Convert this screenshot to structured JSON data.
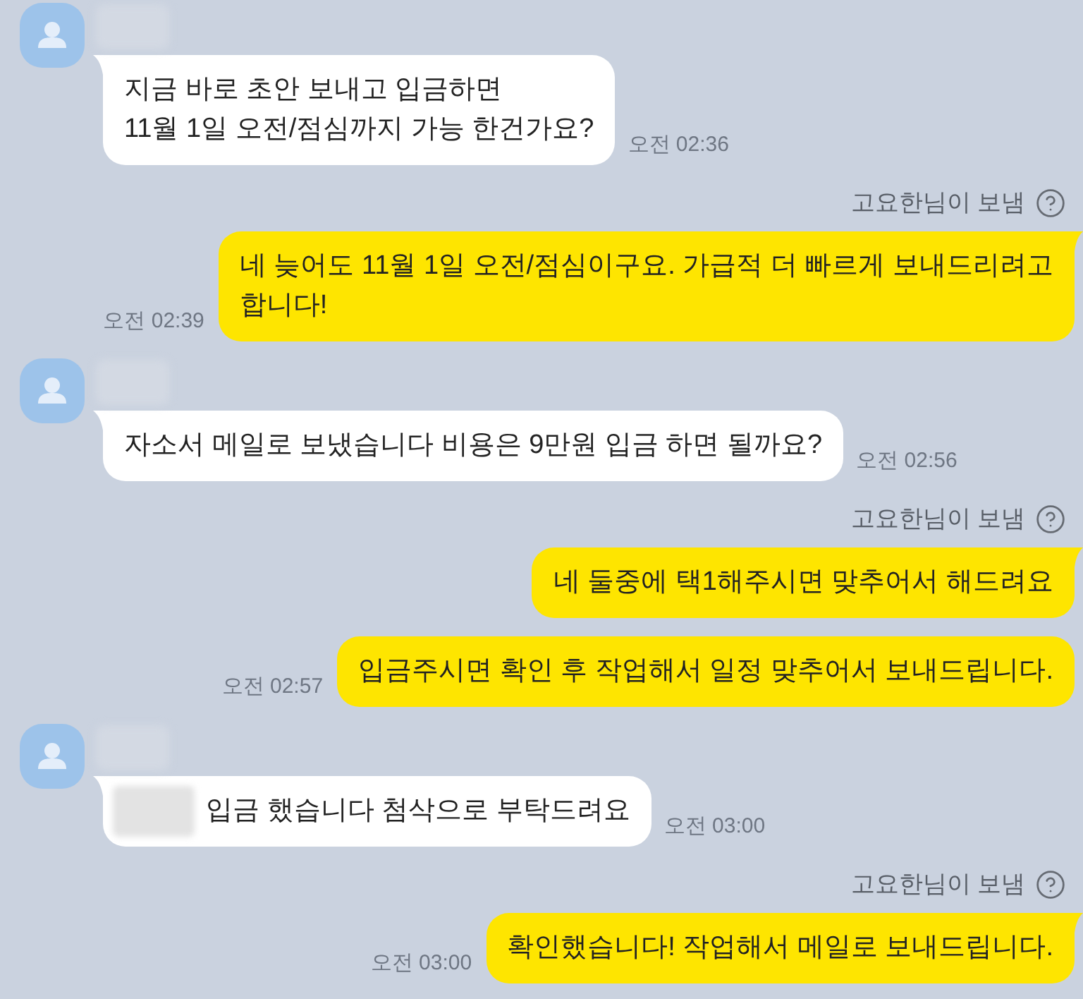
{
  "chat": {
    "groups": [
      {
        "kind": "received",
        "bubbles": [
          {
            "lines": [
              "지금 바로 초안 보내고 입금하면",
              "11월 1일 오전/점심까지 가능 한건가요?"
            ],
            "time": "오전 02:36"
          }
        ]
      },
      {
        "kind": "sent",
        "note": "고요한님이 보냄",
        "bubbles": [
          {
            "lines": [
              "네 늦어도 11월 1일 오전/점심이구요. 가급적 더 빠르게 보내드리려고",
              "합니다!"
            ],
            "time": "오전 02:39"
          }
        ]
      },
      {
        "kind": "received",
        "bubbles": [
          {
            "lines": [
              "자소서 메일로 보냈습니다 비용은 9만원 입금 하면 될까요?"
            ],
            "time": "오전 02:56"
          }
        ]
      },
      {
        "kind": "sent",
        "note": "고요한님이 보냄",
        "bubbles": [
          {
            "lines": [
              "네 둘중에 택1해주시면 맞추어서 해드려요"
            ]
          },
          {
            "lines": [
              "입금주시면 확인 후 작업해서 일정 맞추어서 보내드립니다."
            ],
            "time": "오전 02:57"
          }
        ]
      },
      {
        "kind": "received",
        "bubbles": [
          {
            "lines": [
              "입금 했습니다 첨삭으로 부탁드려요"
            ],
            "time": "오전 03:00",
            "redacted": true
          }
        ]
      },
      {
        "kind": "sent",
        "note": "고요한님이 보냄",
        "bubbles": [
          {
            "lines": [
              "확인했습니다! 작업해서 메일로 보내드립니다."
            ],
            "time": "오전 03:00"
          }
        ]
      }
    ]
  }
}
